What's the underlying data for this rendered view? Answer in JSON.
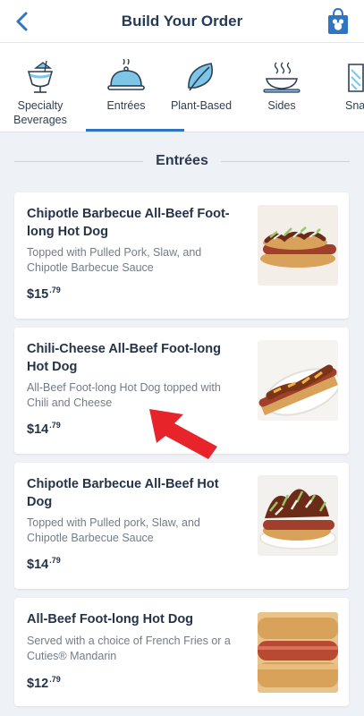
{
  "header": {
    "title": "Build Your Order"
  },
  "tabs": [
    {
      "label": "Specialty Beverages",
      "icon": "beverage-icon"
    },
    {
      "label": "Entrées",
      "icon": "cloche-icon",
      "active": true
    },
    {
      "label": "Plant-Based",
      "icon": "leaf-icon"
    },
    {
      "label": "Sides",
      "icon": "soup-bowl-icon"
    },
    {
      "label": "Snacks",
      "icon": "snack-icon"
    }
  ],
  "section": {
    "title": "Entrées"
  },
  "items": [
    {
      "name": "Chipotle Barbecue All-Beef Foot-long Hot Dog",
      "description": "Topped with Pulled Pork, Slaw, and Chipotle Barbecue Sauce",
      "price_dollars": "$15",
      "price_cents": ".79"
    },
    {
      "name": "Chili-Cheese All-Beef Foot-long Hot Dog",
      "description": "All-Beef Foot-long Hot Dog topped with Chili and Cheese",
      "price_dollars": "$14",
      "price_cents": ".79"
    },
    {
      "name": "Chipotle Barbecue All-Beef Hot Dog",
      "description": "Topped with Pulled pork, Slaw, and Chipotle Barbecue Sauce",
      "price_dollars": "$14",
      "price_cents": ".79"
    },
    {
      "name": "All-Beef Foot-long Hot Dog",
      "description": "Served with a choice of French Fries or a Cuties® Mandarin",
      "price_dollars": "$12",
      "price_cents": ".79"
    }
  ],
  "colors": {
    "accent": "#2f75c3",
    "title": "#253b56",
    "arrow": "#e8242b"
  }
}
